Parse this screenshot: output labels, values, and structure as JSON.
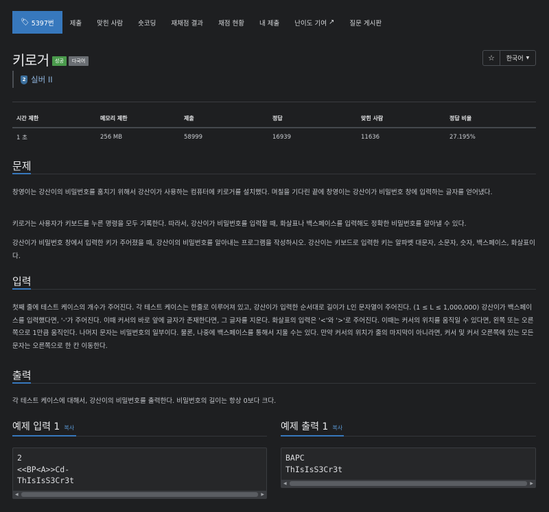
{
  "nav": {
    "tabs": [
      {
        "label": "5397번",
        "icon": "tag-icon"
      },
      {
        "label": "제출"
      },
      {
        "label": "맞힌 사람"
      },
      {
        "label": "숏코딩"
      },
      {
        "label": "재채점 결과"
      },
      {
        "label": "채점 현황"
      },
      {
        "label": "내 제출"
      },
      {
        "label": "난이도 기여",
        "icon": "external-link-icon"
      },
      {
        "label": "질문 게시판"
      }
    ]
  },
  "problem": {
    "title": "키로거",
    "badge_success": "성공",
    "badge_lang": "다국어",
    "tier": "실버 II",
    "tier_icon": "2"
  },
  "controls": {
    "star_icon": "☆",
    "language": "한국어"
  },
  "stats": {
    "headers": [
      "시간 제한",
      "메모리 제한",
      "제출",
      "정답",
      "맞힌 사람",
      "정답 비율"
    ],
    "values": [
      "1 초",
      "256 MB",
      "58999",
      "16939",
      "11636",
      "27.195%"
    ]
  },
  "sections": {
    "problem_title": "문제",
    "problem_p1": "창영이는 강산이의 비밀번호를 훔치기 위해서 강산이가 사용하는 컴퓨터에 키로거를 설치했다. 며칠을 기다린 끝에 창영이는 강산이가 비밀번호 창에 입력하는 글자를 얻어냈다.",
    "problem_p2": "키로거는 사용자가 키보드를 누른 명령을 모두 기록한다. 따라서, 강산이가 비밀번호를 입력할 때, 화살표나 백스페이스를 입력해도 정확한 비밀번호를 알아낼 수 있다.",
    "problem_p3": "강산이가 비밀번호 창에서 입력한 키가 주어졌을 때, 강산이의 비밀번호를 알아내는 프로그램을 작성하시오. 강산이는 키보드로 입력한 키는 알파벳 대문자, 소문자, 숫자, 백스페이스, 화살표이다.",
    "input_title": "입력",
    "input_p": "첫째 줄에 테스트 케이스의 개수가 주어진다. 각 테스트 케이스는 한줄로 이루어져 있고, 강산이가 입력한 순서대로 길이가 L인 문자열이 주어진다. (1 ≤ L ≤ 1,000,000) 강산이가 백스페이스를 입력했다면, '-'가 주어진다. 이때 커서의 바로 앞에 글자가 존재한다면, 그 글자를 지운다. 화살표의 입력은 '<'와 '>'로 주어진다. 이때는 커서의 위치를 움직일 수 있다면, 왼쪽 또는 오른쪽으로 1만큼 움직인다. 나머지 문자는 비밀번호의 일부이다. 물론, 나중에 백스페이스를 통해서 지울 수는 있다. 만약 커서의 위치가 줄의 마지막이 아니라면, 커서 및 커서 오른쪽에 있는 모든 문자는 오른쪽으로 한 칸 이동한다.",
    "output_title": "출력",
    "output_p": "각 테스트 케이스에 대해서, 강산이의 비밀번호를 출력한다. 비밀번호의 길이는 항상 0보다 크다."
  },
  "examples": {
    "input_title": "예제 입력 1",
    "output_title": "예제 출력 1",
    "copy_label": "복사",
    "input_code": "2\n<<BP<A>>Cd-\nThIsIsS3Cr3t",
    "output_code": "BAPC\nThIsIsS3Cr3t"
  },
  "colors": {
    "accent": "#3778bd",
    "success": "#4a9a4c",
    "background": "#1e1f21"
  }
}
